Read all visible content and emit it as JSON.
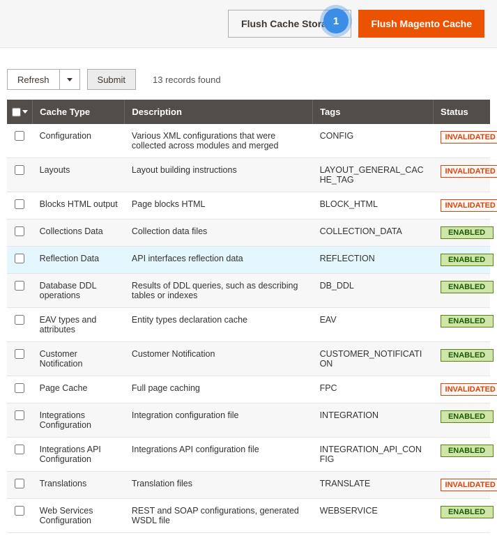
{
  "actions": {
    "flush_storage_label": "Flush Cache Storage",
    "flush_magento_label": "Flush Magento Cache",
    "annotation_number": "1"
  },
  "toolbar": {
    "refresh_label": "Refresh",
    "submit_label": "Submit",
    "records_found": "13 records found"
  },
  "table": {
    "headers": {
      "cache_type": "Cache Type",
      "description": "Description",
      "tags": "Tags",
      "status": "Status"
    },
    "rows": [
      {
        "type": "Configuration",
        "desc": "Various XML configurations that were collected across modules and merged",
        "tags": "CONFIG",
        "status": "INVALIDATED",
        "highlight": false
      },
      {
        "type": "Layouts",
        "desc": "Layout building instructions",
        "tags": "LAYOUT_GENERAL_CACHE_TAG",
        "status": "INVALIDATED",
        "highlight": false
      },
      {
        "type": "Blocks HTML output",
        "desc": "Page blocks HTML",
        "tags": "BLOCK_HTML",
        "status": "INVALIDATED",
        "highlight": false
      },
      {
        "type": "Collections Data",
        "desc": "Collection data files",
        "tags": "COLLECTION_DATA",
        "status": "ENABLED",
        "highlight": false
      },
      {
        "type": "Reflection Data",
        "desc": "API interfaces reflection data",
        "tags": "REFLECTION",
        "status": "ENABLED",
        "highlight": true
      },
      {
        "type": "Database DDL operations",
        "desc": "Results of DDL queries, such as describing tables or indexes",
        "tags": "DB_DDL",
        "status": "ENABLED",
        "highlight": false
      },
      {
        "type": "EAV types and attributes",
        "desc": "Entity types declaration cache",
        "tags": "EAV",
        "status": "ENABLED",
        "highlight": false
      },
      {
        "type": "Customer Notification",
        "desc": "Customer Notification",
        "tags": "CUSTOMER_NOTIFICATION",
        "status": "ENABLED",
        "highlight": false
      },
      {
        "type": "Page Cache",
        "desc": "Full page caching",
        "tags": "FPC",
        "status": "INVALIDATED",
        "highlight": false
      },
      {
        "type": "Integrations Configuration",
        "desc": "Integration configuration file",
        "tags": "INTEGRATION",
        "status": "ENABLED",
        "highlight": false
      },
      {
        "type": "Integrations API Configuration",
        "desc": "Integrations API configuration file",
        "tags": "INTEGRATION_API_CONFIG",
        "status": "ENABLED",
        "highlight": false
      },
      {
        "type": "Translations",
        "desc": "Translation files",
        "tags": "TRANSLATE",
        "status": "INVALIDATED",
        "highlight": false
      },
      {
        "type": "Web Services Configuration",
        "desc": "REST and SOAP configurations, generated WSDL file",
        "tags": "WEBSERVICE",
        "status": "ENABLED",
        "highlight": false
      }
    ]
  },
  "status_labels": {
    "INVALIDATED": "INVALIDATED",
    "ENABLED": "ENABLED"
  }
}
